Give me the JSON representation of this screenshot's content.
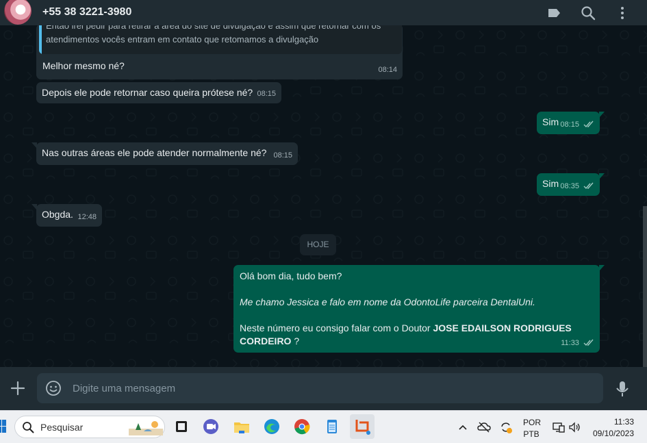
{
  "header": {
    "contact_name": "+55 38 3221-3980"
  },
  "messages": [
    {
      "id": "m1",
      "direction": "in",
      "quoted": "Então irei pedir para retirar a área do site de divulgação e assim que retornar com os atendimentos vocês entram em contato que retomamos a divulgação",
      "text": "Melhor mesmo né?",
      "time": "08:14"
    },
    {
      "id": "m2",
      "direction": "in",
      "text": "Depois ele pode retornar caso queira prótese né?",
      "time": "08:15"
    },
    {
      "id": "m3",
      "direction": "out",
      "text": "Sim",
      "time": "08:15"
    },
    {
      "id": "m4",
      "direction": "in",
      "text": "Nas outras áreas ele pode  atender normalmente né?",
      "time": "08:15"
    },
    {
      "id": "m5",
      "direction": "out",
      "text": "Sim",
      "time": "08:35"
    },
    {
      "id": "m6",
      "direction": "in",
      "text": "Obgda.",
      "time": "12:48"
    }
  ],
  "day_divider": "HOJE",
  "last_message": {
    "line1": "Olá bom dia, tudo bem?",
    "line2": "Me chamo Jessica e falo em nome da OdontoLife parceira DentalUni.",
    "line3_prefix": "Neste número eu consigo falar com o Doutor ",
    "line3_bold1": "JOSE EDAILSON RODRIGUES",
    "line3_bold2": "CORDEIRO",
    "line3_suffix": " ?",
    "time": "11:33"
  },
  "composer": {
    "placeholder": "Digite uma mensagem"
  },
  "taskbar": {
    "search_label": "Pesquisar",
    "lang_top": "POR",
    "lang_bottom": "PTB",
    "clock_time": "11:33",
    "clock_date": "09/10/2023"
  },
  "colors": {
    "incoming_bubble": "#202c33",
    "outgoing_bubble": "#005c4b",
    "chat_background": "#0b141a",
    "read_ticks": "#9fc9c1",
    "quote_bar": "#53bdeb"
  }
}
